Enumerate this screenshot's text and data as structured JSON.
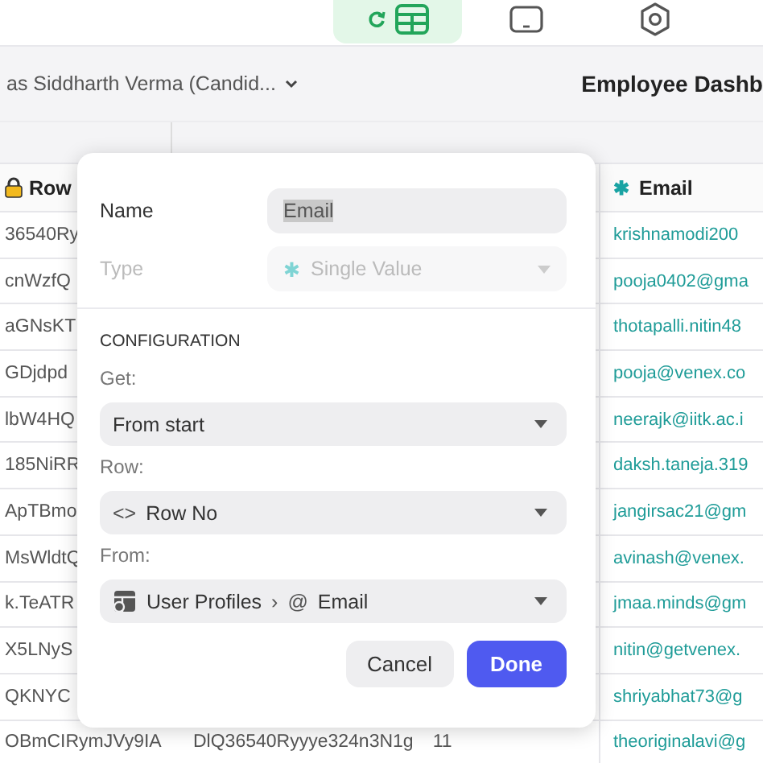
{
  "toolbar": {
    "tabs": [
      {
        "kind": "table",
        "selected": true
      },
      {
        "kind": "tablet",
        "selected": false
      },
      {
        "kind": "settings",
        "selected": false
      }
    ]
  },
  "header": {
    "user": "as Siddharth Verma (Candid...",
    "title": "Employee Dashb"
  },
  "table": {
    "columns": [
      {
        "label": "Row",
        "kind": "locked"
      },
      {
        "label": "Email",
        "icon": "✱",
        "kind": "value"
      }
    ],
    "rows": [
      {
        "id": "36540Ry",
        "email": "krishnamodi200"
      },
      {
        "id": "cnWzfQ",
        "email": "pooja0402@gma"
      },
      {
        "id": "aGNsKT",
        "email": "thotapalli.nitin48"
      },
      {
        "id": "GDjdpd",
        "email": "pooja@venex.co"
      },
      {
        "id": "lbW4HQ",
        "email": "neerajk@iitk.ac.i"
      },
      {
        "id": "185NiRR",
        "email": "daksh.taneja.319"
      },
      {
        "id": "ApTBmo",
        "email": "jangirsac21@gm"
      },
      {
        "id": "MsWldtQ",
        "email": "avinash@venex."
      },
      {
        "id": "k.TeATR",
        "email": "jmaa.minds@gm"
      },
      {
        "id": "X5LNyS",
        "email": "nitin@getvenex."
      },
      {
        "id": "QKNYC",
        "email": "shriyabhat73@g"
      },
      {
        "id": "OBmCIRymJVy9IA",
        "column_2": "DlQ36540Ryyye324n3N1g",
        "column_3": "11",
        "email": "theoriginalavi@g"
      }
    ]
  },
  "dialog": {
    "name_label": "Name",
    "name_value": "Email",
    "name_selected": true,
    "type_label": "Type",
    "type_icon": "✱",
    "type_value": "Single Value",
    "type_disabled": true,
    "section": "CONFIGURATION",
    "fields": [
      {
        "label": "Get:",
        "kind": "plain",
        "value": "From start"
      },
      {
        "label": "Row:",
        "kind": "code",
        "icon": "<>",
        "value": "Row No"
      },
      {
        "label": "From:",
        "kind": "path",
        "table": "User Profiles",
        "separator": "›",
        "column_icon": "@",
        "value": "Email"
      }
    ],
    "buttons": [
      {
        "label": "Cancel",
        "kind": "secondary"
      },
      {
        "label": "Done",
        "kind": "primary"
      }
    ]
  }
}
